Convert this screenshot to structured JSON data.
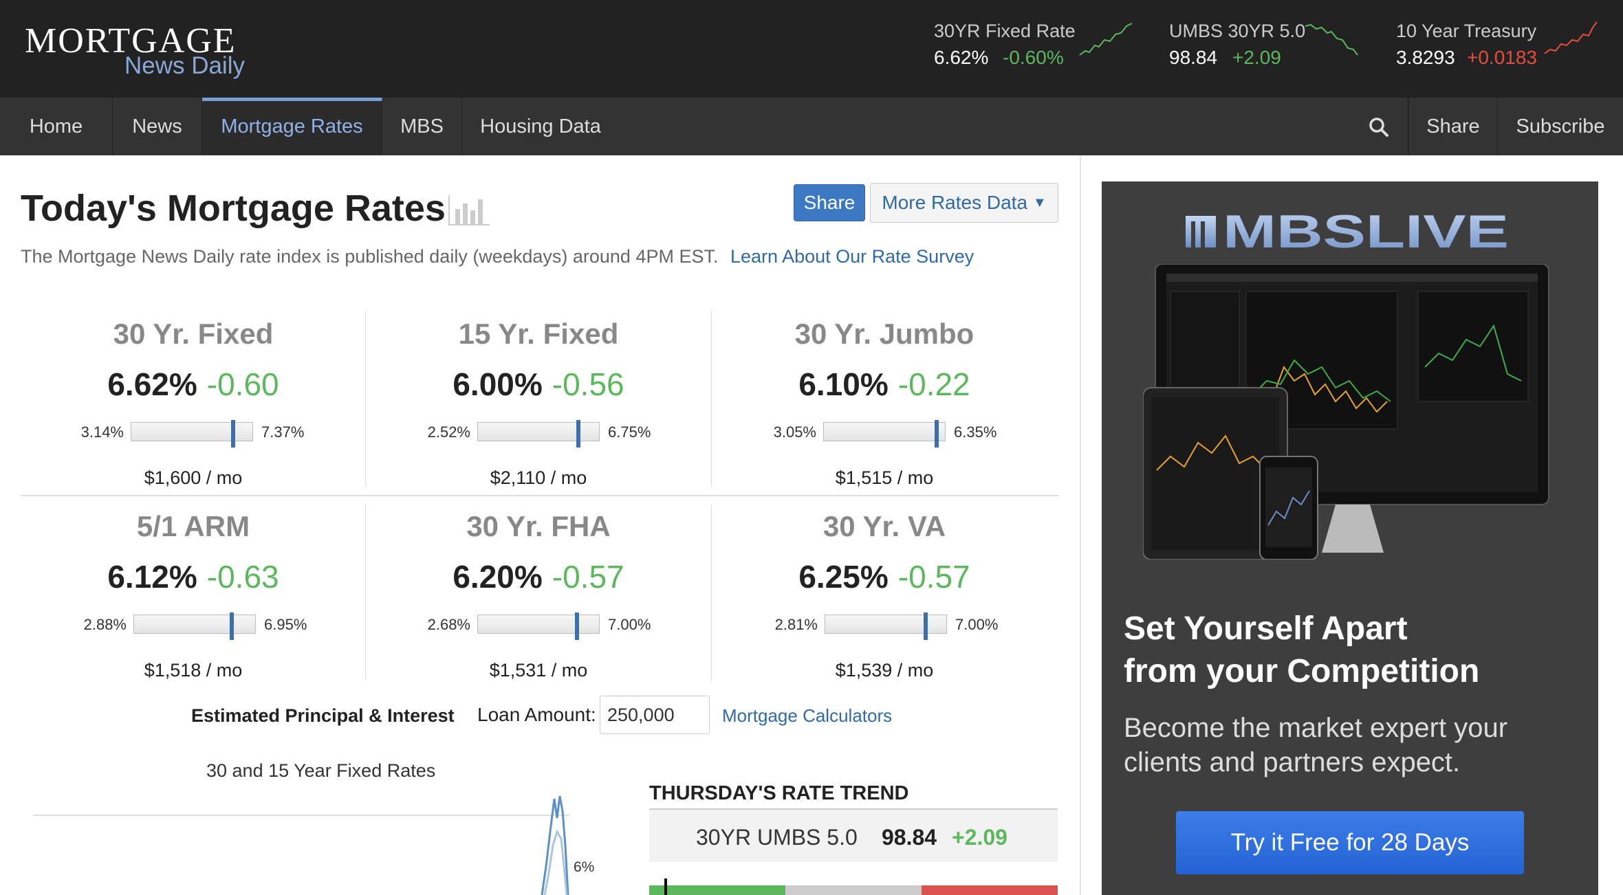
{
  "brand": {
    "logo_main": "MORTGAGE",
    "logo_sub": "News Daily"
  },
  "tickers": [
    {
      "label": "30YR Fixed Rate",
      "value": "6.62%",
      "change": "-0.60%",
      "direction": "up"
    },
    {
      "label": "UMBS 30YR 5.0",
      "value": "98.84",
      "change": "+2.09",
      "direction": "up"
    },
    {
      "label": "10 Year Treasury",
      "value": "3.8293",
      "change": "+0.0183",
      "direction": "down"
    }
  ],
  "nav": {
    "items": [
      "Home",
      "News",
      "Mortgage Rates",
      "MBS",
      "Housing Data"
    ],
    "active": "Mortgage Rates",
    "share": "Share",
    "subscribe": "Subscribe"
  },
  "header": {
    "title": "Today's Mortgage Rates",
    "share_button": "Share",
    "more_button": "More Rates Data",
    "subtitle": "The Mortgage News Daily rate index is published daily (weekdays) around 4PM EST.",
    "subtitle_link": "Learn About Our Rate Survey"
  },
  "rates": [
    {
      "name": "30 Yr. Fixed",
      "rate": "6.62%",
      "change": "-0.60",
      "low": "3.14%",
      "high": "7.37%",
      "position": 0.83,
      "payment": "$1,600 / mo"
    },
    {
      "name": "15 Yr. Fixed",
      "rate": "6.00%",
      "change": "-0.56",
      "low": "2.52%",
      "high": "6.75%",
      "position": 0.82,
      "payment": "$2,110 / mo"
    },
    {
      "name": "30 Yr. Jumbo",
      "rate": "6.10%",
      "change": "-0.22",
      "low": "3.05%",
      "high": "6.35%",
      "position": 0.92,
      "payment": "$1,515 / mo"
    },
    {
      "name": "5/1 ARM",
      "rate": "6.12%",
      "change": "-0.63",
      "low": "2.88%",
      "high": "6.95%",
      "position": 0.8,
      "payment": "$1,518 / mo"
    },
    {
      "name": "30 Yr. FHA",
      "rate": "6.20%",
      "change": "-0.57",
      "low": "2.68%",
      "high": "7.00%",
      "position": 0.81,
      "payment": "$1,531 / mo"
    },
    {
      "name": "30 Yr. VA",
      "rate": "6.25%",
      "change": "-0.57",
      "low": "2.81%",
      "high": "7.00%",
      "position": 0.82,
      "payment": "$1,539 / mo"
    }
  ],
  "calculator": {
    "pi_label": "Estimated Principal & Interest",
    "loan_label": "Loan Amount:",
    "loan_value": "250,000",
    "calc_link": "Mortgage Calculators"
  },
  "mini_chart": {
    "title": "30 and 15 Year Fixed Rates",
    "tick": "6%"
  },
  "trend": {
    "title": "THURSDAY'S RATE TREND",
    "label": "30YR UMBS 5.0",
    "value": "98.84",
    "change": "+2.09"
  },
  "ad": {
    "logo": "MBSLIVE",
    "headline_1": "Set Yourself Apart",
    "headline_2": "from your Competition",
    "body_1": "Become the market expert your",
    "body_2": "clients and partners expect.",
    "cta": "Try it Free for 28 Days"
  },
  "colors": {
    "positive": "#5cb85c",
    "negative": "#e74c3c",
    "link": "#2f6aa6",
    "accent": "#3d79c2"
  }
}
